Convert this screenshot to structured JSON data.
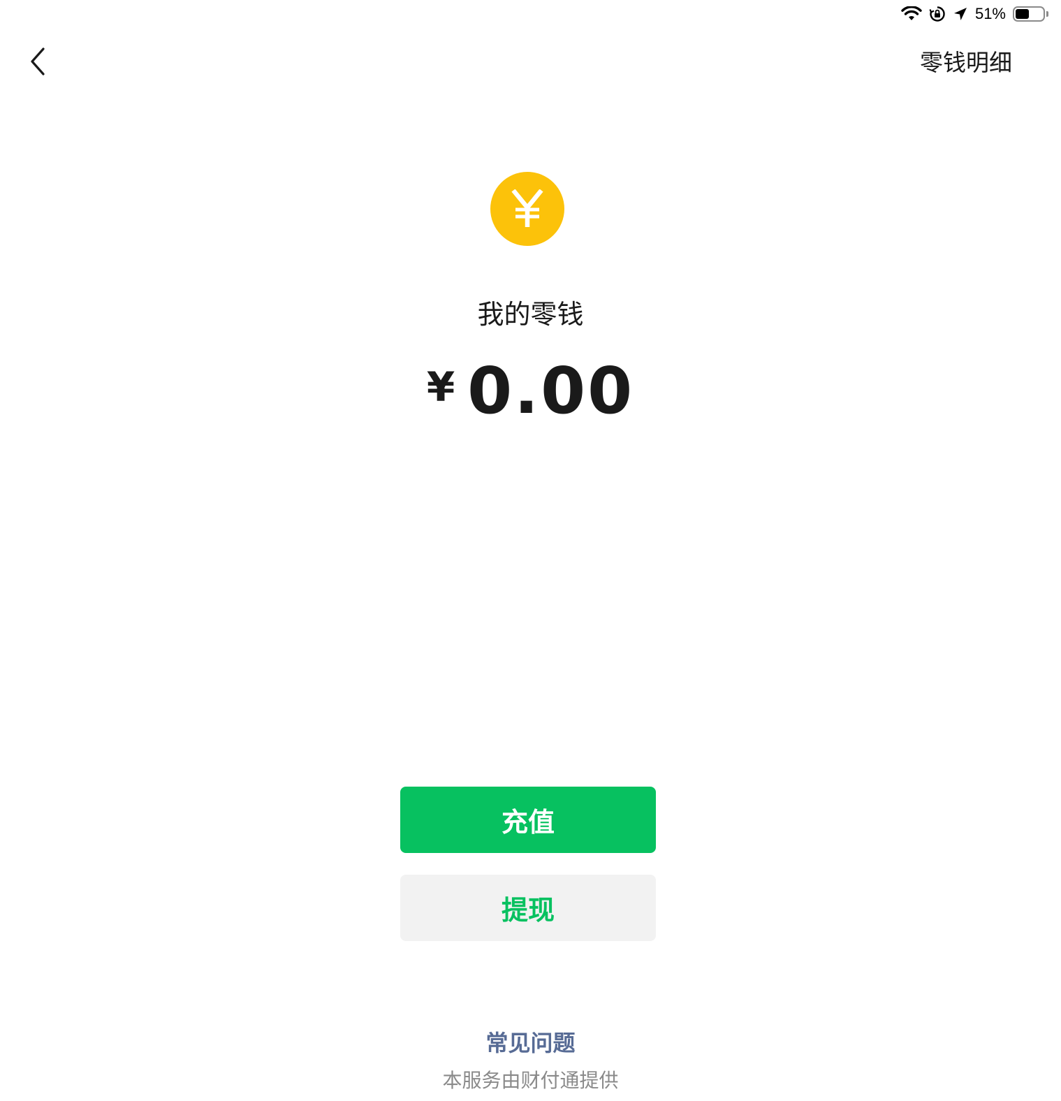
{
  "status_bar": {
    "battery_percent": "51%",
    "battery_level": 0.51,
    "icons": [
      "wifi-icon",
      "rotation-lock-icon",
      "location-arrow-icon",
      "battery-icon"
    ]
  },
  "nav": {
    "back_icon": "chevron-left-icon",
    "detail_link": "零钱明细"
  },
  "wallet": {
    "coin_symbol": "¥",
    "title": "我的零钱",
    "currency": "¥",
    "amount": "0.00"
  },
  "actions": {
    "recharge_label": "充值",
    "withdraw_label": "提现"
  },
  "footer": {
    "faq_label": "常见问题",
    "provider_note": "本服务由财付通提供"
  },
  "colors": {
    "primary_green": "#07c160",
    "coin_yellow": "#fcc20a",
    "link_blue": "#576b95",
    "secondary_button_bg": "#f2f2f2"
  }
}
